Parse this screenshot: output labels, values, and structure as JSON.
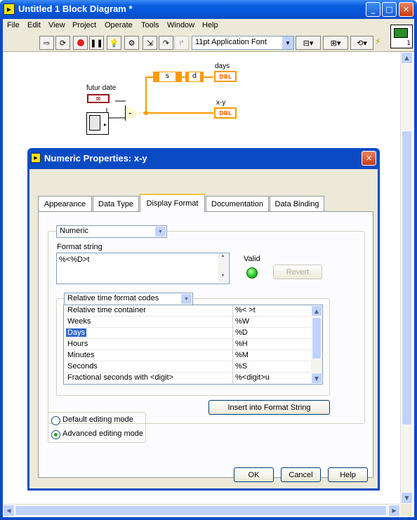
{
  "window": {
    "title": "Untitled 1 Block Diagram *"
  },
  "menu": [
    "File",
    "Edit",
    "View",
    "Project",
    "Operate",
    "Tools",
    "Window",
    "Help"
  ],
  "toolbar": {
    "font": "11pt Application Font"
  },
  "diagram": {
    "futur_date_label": "futur date",
    "days_label": "days",
    "xy_label": "x-y",
    "s_label": "s",
    "d_label": "d",
    "dbl": "DBL",
    "subtract": "-"
  },
  "dialog": {
    "title": "Numeric Properties: x-y",
    "tabs": [
      "Appearance",
      "Data Type",
      "Display Format",
      "Documentation",
      "Data Binding"
    ],
    "active_tab": "Display Format",
    "type_select": "Numeric",
    "format_string_label": "Format string",
    "format_string": "%<%D>t",
    "valid_label": "Valid",
    "revert_label": "Revert",
    "codes_select": "Relative time format codes",
    "codes": [
      {
        "name": "Relative time container",
        "code": "%< >t"
      },
      {
        "name": "Weeks",
        "code": "%W"
      },
      {
        "name": "Days",
        "code": "%D"
      },
      {
        "name": "Hours",
        "code": "%H"
      },
      {
        "name": "Minutes",
        "code": "%M"
      },
      {
        "name": "Seconds",
        "code": "%S"
      },
      {
        "name": "Fractional seconds with <digit>",
        "code": "%<digit>u"
      }
    ],
    "insert_label": "Insert into Format String",
    "mode_default": "Default editing mode",
    "mode_advanced": "Advanced editing mode",
    "ok": "OK",
    "cancel": "Cancel",
    "help": "Help"
  },
  "colors": {
    "title_blue": "#0a5fe0",
    "orange_wire": "#ff9a00",
    "valid_green": "#2bd12b",
    "selection": "#316ac5"
  }
}
